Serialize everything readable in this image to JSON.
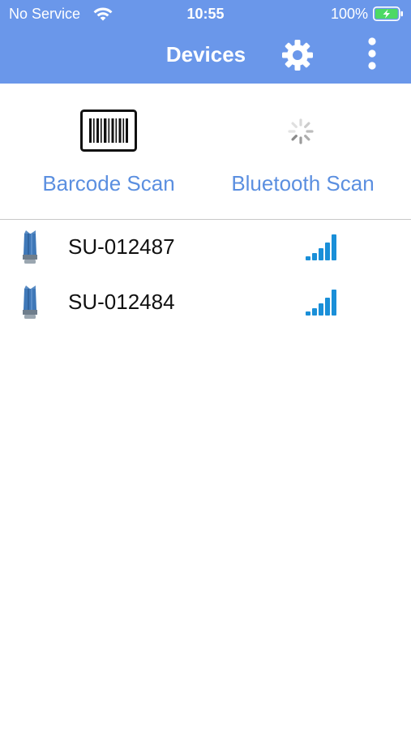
{
  "status_bar": {
    "carrier": "No Service",
    "time": "10:55",
    "battery": "100%"
  },
  "nav": {
    "title": "Devices",
    "icons": [
      "gear-icon",
      "more-vertical-icon"
    ]
  },
  "scan_options": [
    {
      "label": "Barcode Scan",
      "icon": "barcode-icon"
    },
    {
      "label": "Bluetooth Scan",
      "icon": "spinner-icon"
    }
  ],
  "devices": [
    {
      "name": "SU-012487",
      "signal_bars": 5,
      "max_bars": 5
    },
    {
      "name": "SU-012484",
      "signal_bars": 5,
      "max_bars": 5
    }
  ],
  "colors": {
    "header_bg": "#6a97ea",
    "accent_text": "#5b8fe0",
    "signal": "#1a8fd8",
    "device_icon": "#3f78b8",
    "battery_charging": "#4cd964"
  }
}
